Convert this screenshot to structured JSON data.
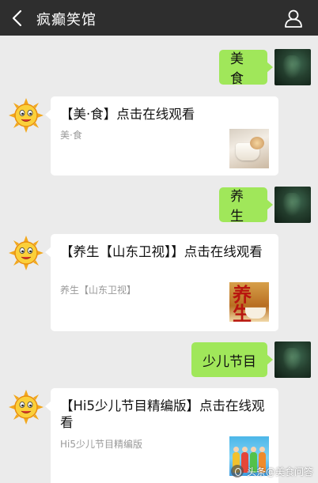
{
  "header": {
    "title": "疯癫笑馆",
    "back_icon": "chevron-left-icon",
    "profile_icon": "person-icon",
    "background": "#2e2e2e"
  },
  "messages": [
    {
      "type": "sent",
      "text": "美食"
    },
    {
      "type": "card",
      "title": "【美·食】点击在线观看",
      "desc": "美·食",
      "thumb": "food-thumbnail"
    },
    {
      "type": "sent",
      "text": "养生"
    },
    {
      "type": "card",
      "title": "【养生【山东卫视】】点击在线观看",
      "desc": "养生【山东卫视】",
      "thumb": "health-thumbnail",
      "thumb_text": "养生"
    },
    {
      "type": "sent",
      "text": "少儿节目"
    },
    {
      "type": "card",
      "title": "【Hi5少儿节目精编版】点击在线观看",
      "desc": "Hi5少儿节目精编版",
      "thumb": "kids-thumbnail"
    }
  ],
  "watermark": {
    "text": "头条@美食问答"
  },
  "colors": {
    "chat_bg": "#ebebeb",
    "sent_bubble": "#a0e75a",
    "card_bg": "#ffffff",
    "desc_text": "#999999"
  }
}
